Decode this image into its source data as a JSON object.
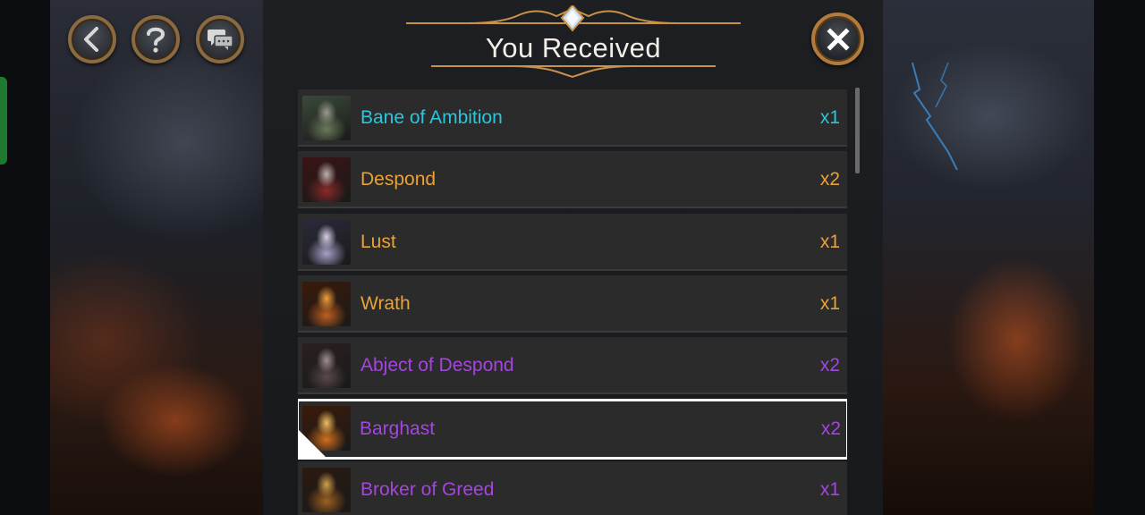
{
  "header": {
    "title": "You Received"
  },
  "top_buttons": {
    "back_icon": "chevron-left-icon",
    "help_icon": "question-mark-icon",
    "chat_icon": "chat-bubbles-icon",
    "close_icon": "x-icon"
  },
  "colors": {
    "cyan": "#27c8dd",
    "orange": "#e9a234",
    "purple": "#a545e0",
    "gold_frame": "#c8924a"
  },
  "rewards": [
    {
      "name": "Bane of Ambition",
      "qty": "x1",
      "rarity": "cyan"
    },
    {
      "name": "Despond",
      "qty": "x2",
      "rarity": "orange"
    },
    {
      "name": "Lust",
      "qty": "x1",
      "rarity": "orange"
    },
    {
      "name": "Wrath",
      "qty": "x1",
      "rarity": "orange"
    },
    {
      "name": "Abject of Despond",
      "qty": "x2",
      "rarity": "purple"
    },
    {
      "name": "Barghast",
      "qty": "x2",
      "rarity": "purple",
      "selected": true
    },
    {
      "name": "Broker of Greed",
      "qty": "x1",
      "rarity": "purple"
    }
  ]
}
